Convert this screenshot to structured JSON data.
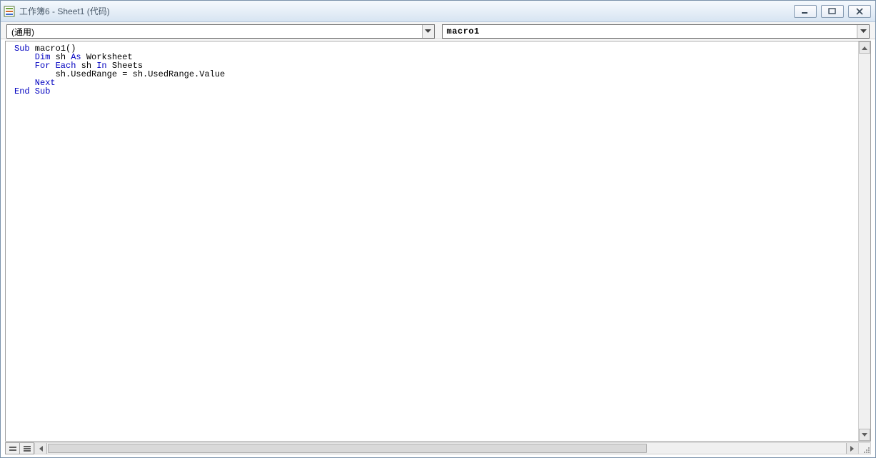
{
  "window": {
    "title": "工作簿6 - Sheet1 (代码)"
  },
  "dropdowns": {
    "object": {
      "value": "(通用)"
    },
    "procedure": {
      "value": "macro1"
    }
  },
  "code": {
    "l1a": "Sub",
    "l1b": " macro1()",
    "l2a": "    Dim",
    "l2b": " sh ",
    "l2c": "As",
    "l2d": " Worksheet",
    "l3a": "    For Each",
    "l3b": " sh ",
    "l3c": "In",
    "l3d": " Sheets",
    "l4": "        sh.UsedRange = sh.UsedRange.Value",
    "l5": "    Next",
    "l6": "End Sub"
  }
}
